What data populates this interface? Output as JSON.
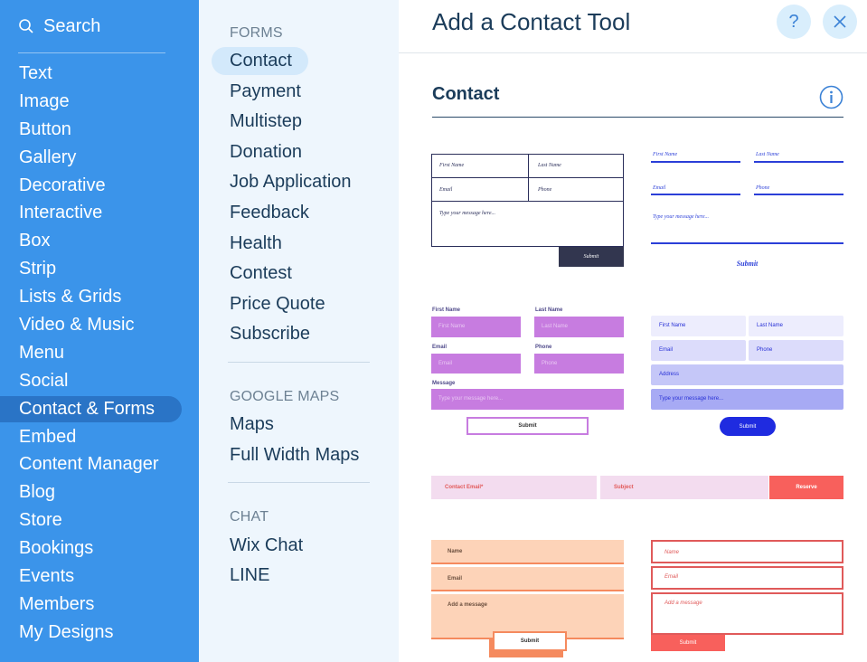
{
  "sidebar": {
    "search_label": "Search",
    "items": [
      "Text",
      "Image",
      "Button",
      "Gallery",
      "Decorative",
      "Interactive",
      "Box",
      "Strip",
      "Lists & Grids",
      "Video & Music",
      "Menu",
      "Social",
      "Contact & Forms",
      "Embed",
      "Content Manager",
      "Blog",
      "Store",
      "Bookings",
      "Events",
      "Members",
      "My Designs"
    ],
    "selected": "Contact & Forms"
  },
  "middle": {
    "forms_title": "FORMS",
    "forms_items": [
      "Contact",
      "Payment",
      "Multistep",
      "Donation",
      "Job Application",
      "Feedback",
      "Health",
      "Contest",
      "Price Quote",
      "Subscribe"
    ],
    "maps_title": "GOOGLE MAPS",
    "maps_items": [
      "Maps",
      "Full Width Maps"
    ],
    "chat_title": "CHAT",
    "chat_items": [
      "Wix Chat",
      "LINE"
    ],
    "selected": "Contact"
  },
  "panel": {
    "title": "Add a Contact Tool",
    "help_label": "?",
    "section_heading": "Contact"
  },
  "templates": {
    "t1": {
      "first_name": "First Name",
      "last_name": "Last Name",
      "email": "Email",
      "phone": "Phone",
      "message": "Type your message here...",
      "submit": "Submit"
    },
    "t2": {
      "first_name": "First Name",
      "last_name": "Last Name",
      "email": "Email",
      "phone": "Phone",
      "message": "Type your message here...",
      "submit": "Submit"
    },
    "t3": {
      "first_name": "First Name",
      "last_name": "Last Name",
      "first_name_ph": "First Name",
      "last_name_ph": "Last Name",
      "email": "Email",
      "phone": "Phone",
      "email_ph": "Email",
      "phone_ph": "Phone",
      "message": "Message",
      "message_ph": "Type your message here...",
      "submit": "Submit"
    },
    "t4": {
      "first_name": "First Name",
      "last_name": "Last Name",
      "email": "Email",
      "phone": "Phone",
      "address": "Address",
      "message": "Type your message here...",
      "submit": "Submit"
    },
    "t5": {
      "email": "Contact Email*",
      "subject": "Subject",
      "submit": "Reserve"
    },
    "t6": {
      "name": "Name",
      "email": "Email",
      "message": "Add a message",
      "submit": "Submit"
    },
    "t7": {
      "name": "Name",
      "email": "Email",
      "message": "Add a message",
      "submit": "Submit"
    }
  },
  "colors": {
    "sidebar_bg": "#3b94ea",
    "sidebar_selected": "#2a74c6",
    "middle_bg": "#eef6fd",
    "accent_blue": "#3b82d6",
    "t3_purple": "#c77ce0",
    "t4_blue": "#2730d6",
    "t5_coral": "#f8605c",
    "t6_peach": "#fdd3b8"
  }
}
